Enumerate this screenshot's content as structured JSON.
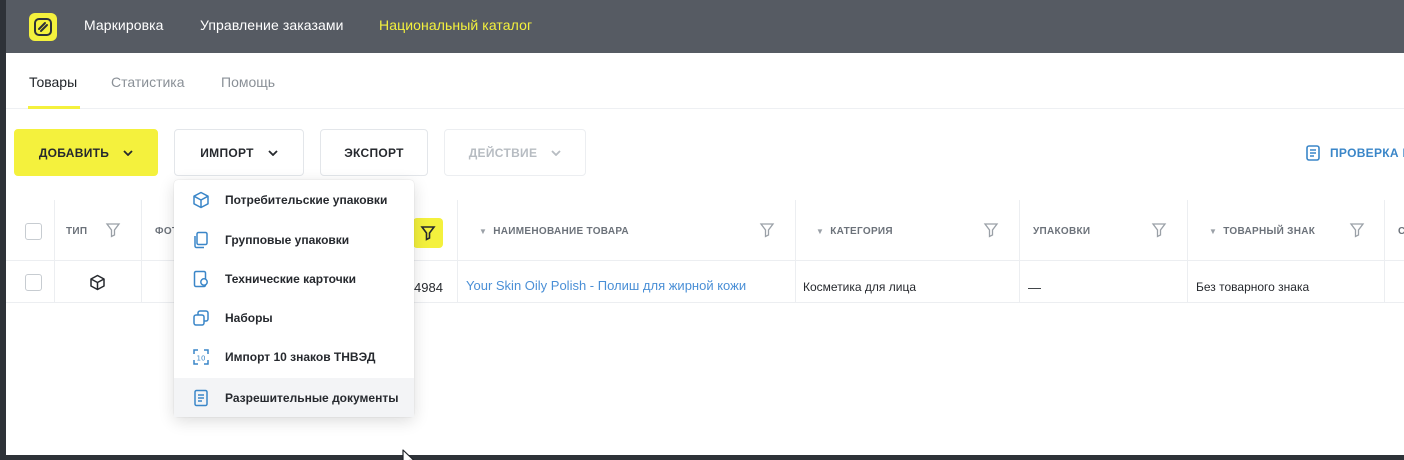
{
  "header": {
    "nav": [
      "Маркировка",
      "Управление заказами",
      "Национальный каталог"
    ],
    "active_nav": "Национальный каталог",
    "accent_color": "#f4f13d"
  },
  "subnav": {
    "tabs": [
      "Товары",
      "Статистика",
      "Помощь"
    ],
    "active_tab": "Товары"
  },
  "toolbar": {
    "add_label": "ДОБАВИТЬ",
    "import_label": "ИМПОРТ",
    "export_label": "ЭКСПОРТ",
    "action_label": "ДЕЙСТВИЕ",
    "check_label": "ПРОВЕРКА I"
  },
  "import_menu": {
    "items": [
      {
        "label": "Потребительские упаковки",
        "icon": "box-icon"
      },
      {
        "label": "Групповые упаковки",
        "icon": "copy-icon"
      },
      {
        "label": "Технические карточки",
        "icon": "tech-card-icon"
      },
      {
        "label": "Наборы",
        "icon": "set-icon"
      },
      {
        "label": "Импорт 10 знаков ТНВЭД",
        "icon": "tnved-icon"
      },
      {
        "label": "Разрешительные документы",
        "icon": "document-icon"
      }
    ],
    "hovered_index": 5
  },
  "table": {
    "headers": {
      "type": "ТИП",
      "photo": "ФОТ",
      "name": "НАИМЕНОВАНИЕ ТОВАРА",
      "category": "КАТЕГОРИЯ",
      "packages": "УПАКОВКИ",
      "trademark": "ТОВАРНЫЙ ЗНАК",
      "more": "С"
    },
    "rows": [
      {
        "type_icon": "box-icon",
        "code_tail": "4984",
        "name": "Your Skin Oily Polish - Полиш для жирной кожи",
        "category": "Косметика для лица",
        "packages": "—",
        "trademark": "Без товарного знака"
      }
    ]
  }
}
